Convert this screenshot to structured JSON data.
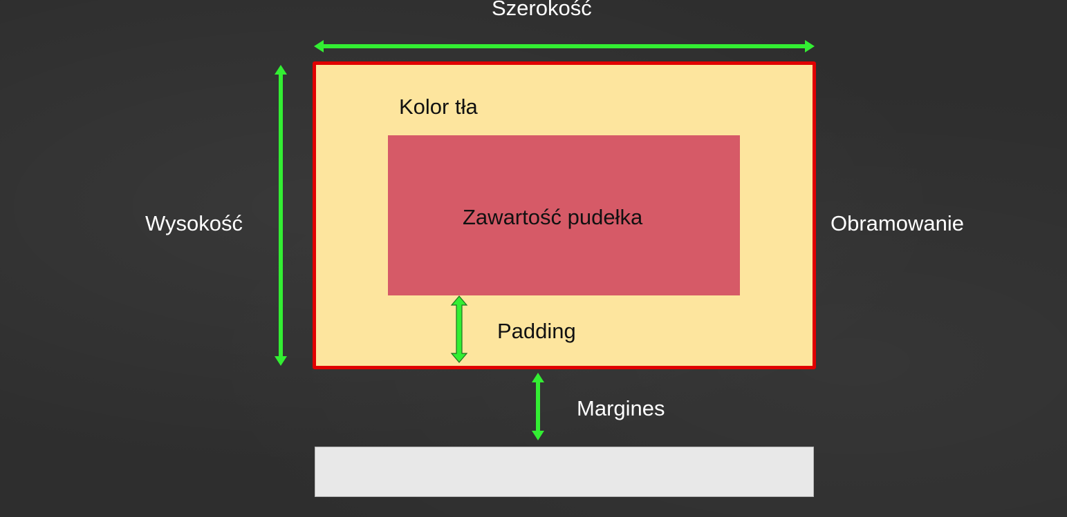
{
  "diagram": {
    "labels": {
      "width": "Szerokość",
      "height": "Wysokość",
      "border": "Obramowanie",
      "background": "Kolor tła",
      "content": "Zawartość pudełka",
      "padding": "Padding",
      "margin": "Margines"
    },
    "colors": {
      "background": "#2e2e2e",
      "arrow": "#33ee33",
      "border": "#e00000",
      "padding_area": "#fde59e",
      "content": "#d65a67",
      "next_box": "#e8e8e8"
    }
  }
}
